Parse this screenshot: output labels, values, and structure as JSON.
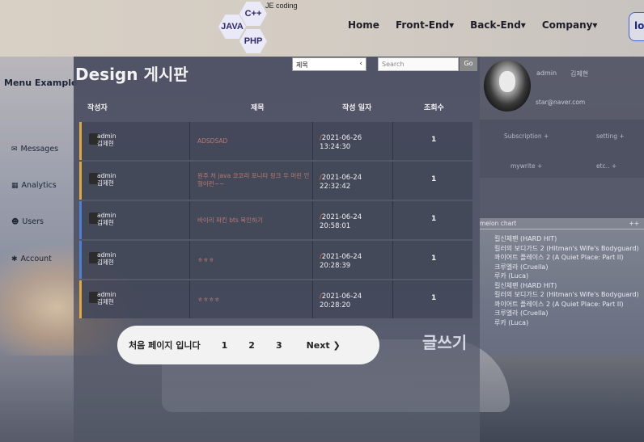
{
  "header": {
    "logo": {
      "tagline": "JE coding",
      "badges": [
        "C++",
        "JAVA",
        "PHP"
      ]
    },
    "nav": [
      {
        "label": "Home"
      },
      {
        "label": "Front-End▾"
      },
      {
        "label": "Back-End▾"
      },
      {
        "label": "Company▾"
      }
    ],
    "login_label": "log"
  },
  "sidebar": {
    "title": "Menu Example",
    "items": [
      {
        "label": "Messages",
        "icon": "envelope-icon",
        "glyph": "✉"
      },
      {
        "label": "Analytics",
        "icon": "chart-icon",
        "glyph": "▦"
      },
      {
        "label": "Users",
        "icon": "users-icon",
        "glyph": "☻"
      },
      {
        "label": "Account",
        "icon": "gear-icon",
        "glyph": "✱"
      }
    ]
  },
  "board": {
    "title": "Design 게시판",
    "search": {
      "selected": "제목",
      "placeholder": "Search",
      "go_label": "Go"
    },
    "columns": [
      "작성자",
      "제목",
      "작성 일자",
      "조회수"
    ],
    "rows": [
      {
        "author_id": "admin",
        "author_name": "김제현",
        "subject": "ADSDSAD",
        "date": "2021-06-26",
        "time": "13:24:30",
        "views": "1",
        "accent": "#e0a83a"
      },
      {
        "author_id": "admin",
        "author_name": "김제현",
        "subject": "원주 처 java 코코리 포니타 핑크 우 머린 인형이런~~",
        "date": "2021-06-24",
        "time": "22:32:42",
        "views": "1",
        "accent": "#e0a83a"
      },
      {
        "author_id": "admin",
        "author_name": "김제현",
        "subject": "바이리 파킨 bts 목인하기",
        "date": "2021-06-24",
        "time": "20:58:01",
        "views": "1",
        "accent": "#4d7fd6"
      },
      {
        "author_id": "admin",
        "author_name": "김제현",
        "subject": "ㅎㅎㅎ",
        "date": "2021-06-24",
        "time": "20:28:39",
        "views": "1",
        "accent": "#4d7fd6"
      },
      {
        "author_id": "admin",
        "author_name": "김제현",
        "subject": "ㅎㅎㅎㅎ",
        "date": "2021-06-24",
        "time": "20:28:20",
        "views": "1",
        "accent": "#e0a83a"
      }
    ],
    "pager": {
      "first_label": "처음 페이지 입니다",
      "pages": [
        "1",
        "2",
        "3"
      ],
      "next_label": "Next ❯"
    },
    "write_label": "글쓰기"
  },
  "profile": {
    "username": "admin",
    "realname": "김제현",
    "email": "star@naver.com",
    "links": [
      "Subscription +",
      "setting +",
      "mywrite +",
      "etc.. +"
    ]
  },
  "melon": {
    "title": "melon chart",
    "plus": "++",
    "items": [
      "킬신체팬 (HARD HIT)",
      "킬러의 보디가드 2 (Hitman's Wife's Bodyguard)",
      "콰이어트 플레이스 2 (A Quiet Place: Part II)",
      "크루엘라 (Cruella)",
      "루카 (Luca)",
      "킬신체팬 (HARD HIT)",
      "킬러의 보디가드 2 (Hitman's Wife's Bodyguard)",
      "콰이어트 플레이스 2 (A Quiet Place: Part II)",
      "크루엘라 (Cruella)",
      "루카 (Luca)"
    ]
  }
}
